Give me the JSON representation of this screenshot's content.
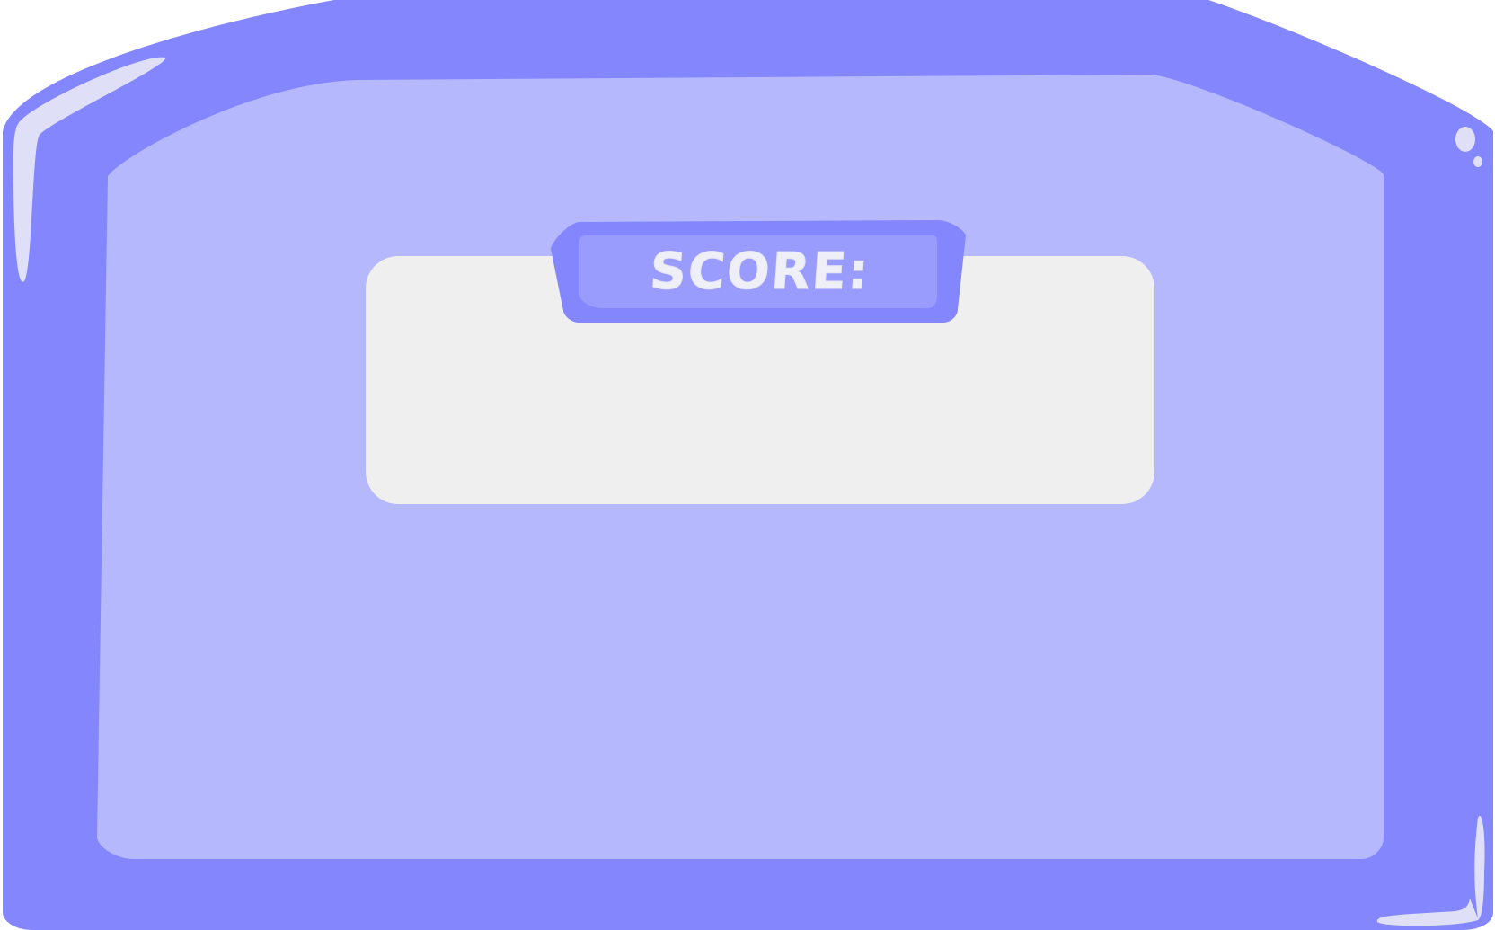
{
  "panel": {
    "score_label": "SCORE:",
    "score_value": "",
    "icon": "score-panel-frame"
  },
  "colors": {
    "frame": "#8386fd",
    "inner_panel": "#b6b8fd",
    "tab": "#8386fd",
    "tab_inner": "#999cfd",
    "score_box": "#efefef",
    "highlight": "#dfe0f8",
    "label_text": "#efeff8"
  }
}
